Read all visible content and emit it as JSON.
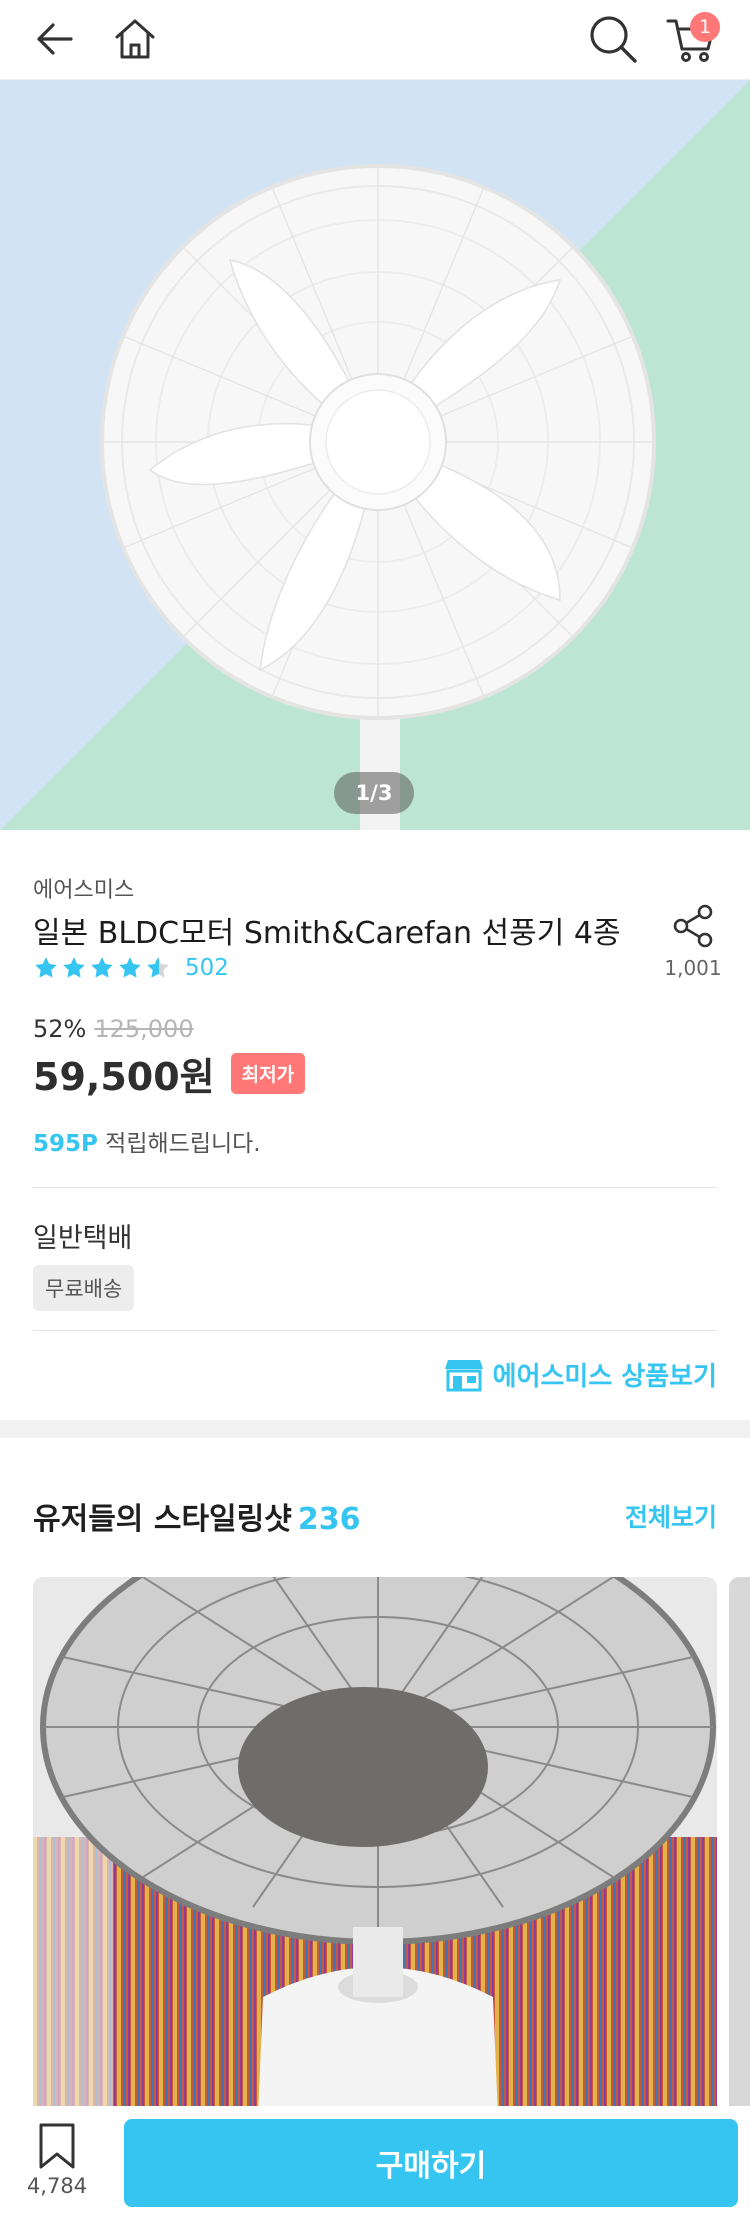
{
  "topbar": {
    "back_icon": "arrow-left-icon",
    "home_icon": "home-icon",
    "search_icon": "search-icon",
    "cart_icon": "cart-icon",
    "cart_count": "1"
  },
  "hero": {
    "pager": "1/3",
    "colors": {
      "left": "#d2e4f4",
      "right": "#bce6d3"
    }
  },
  "product": {
    "brand": "에어스미스",
    "title": "일본 BLDC모터 Smith&Carefan 선풍기 4종",
    "rating": 4.5,
    "review_count": "502",
    "share_count": "1,001",
    "discount_pct": "52%",
    "original_price": "125,000",
    "price": "59,500원",
    "lowest_badge": "최저가",
    "points_value": "595P",
    "points_text": " 적립해드립니다."
  },
  "shipping": {
    "label": "일반택배",
    "tag": "무료배송"
  },
  "store": {
    "link_label": "에어스미스 상품보기"
  },
  "styling": {
    "title": "유저들의 스타일링샷",
    "count": "236",
    "see_all": "전체보기"
  },
  "bottom": {
    "bookmark_count": "4,784",
    "buy_label": "구매하기"
  },
  "colors": {
    "accent": "#35c5f0",
    "badge": "#ff7777"
  }
}
